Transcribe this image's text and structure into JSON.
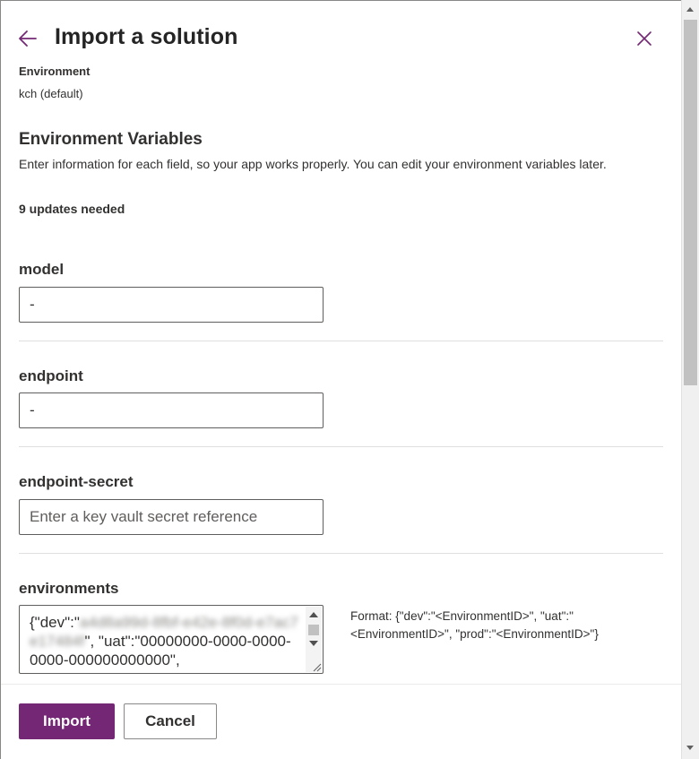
{
  "header": {
    "title": "Import a solution",
    "back_icon": "arrow-left-icon",
    "close_icon": "close-icon"
  },
  "environment": {
    "label": "Environment",
    "value": "kch (default)"
  },
  "variables": {
    "title": "Environment Variables",
    "description": "Enter information for each field, so your app works properly. You can edit your environment variables later.",
    "updates": "9 updates needed"
  },
  "fields": [
    {
      "label": "model",
      "value": "-",
      "placeholder": ""
    },
    {
      "label": "endpoint",
      "value": "-",
      "placeholder": ""
    },
    {
      "label": "endpoint-secret",
      "value": "",
      "placeholder": "Enter a key vault secret reference"
    }
  ],
  "environments_field": {
    "label": "environments",
    "text_prefix": "{\"dev\":\"",
    "text_blurred": "a4d8a99d-8fbf-e42e-8f0d-e7ac7e17484f",
    "text_suffix": "\", \"uat\":\"00000000-0000-0000-0000-000000000000\",",
    "hint": "Format: {\"dev\":\"<EnvironmentID>\", \"uat\":\"<EnvironmentID>\", \"prod\":\"<EnvironmentID>\"}"
  },
  "footer": {
    "import_label": "Import",
    "cancel_label": "Cancel"
  },
  "colors": {
    "accent": "#742774",
    "border": "#605e5c",
    "divider": "#e1dfdd"
  }
}
